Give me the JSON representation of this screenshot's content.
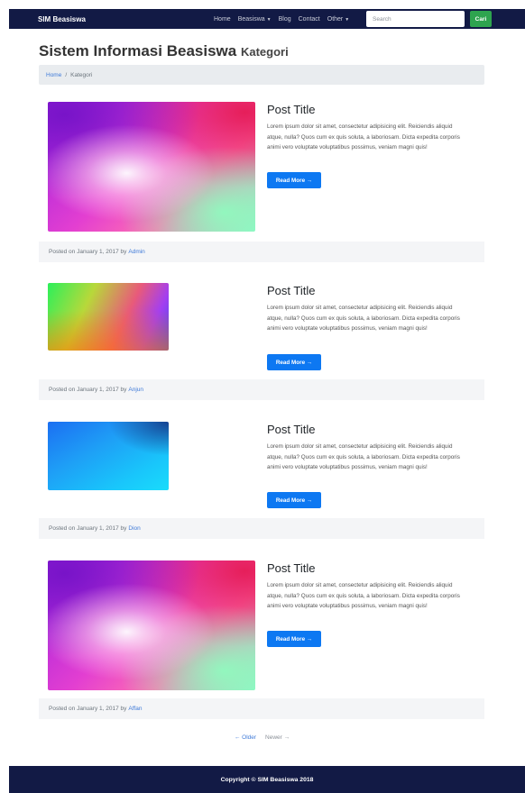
{
  "navbar": {
    "brand": "SIM Beasiswa",
    "links": [
      {
        "label": "Home"
      },
      {
        "label": "Beasiswa",
        "dropdown": true
      },
      {
        "label": "Blog"
      },
      {
        "label": "Contact"
      },
      {
        "label": "Other",
        "dropdown": true
      }
    ],
    "search_placeholder": "Search",
    "search_button": "Cari"
  },
  "header": {
    "title": "Sistem Informasi Beasiswa",
    "subtitle": "Kategori"
  },
  "breadcrumb": {
    "home": "Home",
    "separator": "/",
    "current": "Kategori"
  },
  "posts": [
    {
      "title": "Post Title",
      "text": "Lorem ipsum dolor sit amet, consectetur adipisicing elit. Reiciendis aliquid atque, nulla? Quos cum ex quis soluta, a laboriosam. Dicta expedita corporis animi vero voluptate voluptatibus possimus, veniam magni quis!",
      "button": "Read More →",
      "posted": "Posted on January 1, 2017 by",
      "author": "Admin"
    },
    {
      "title": "Post Title",
      "text": "Lorem ipsum dolor sit amet, consectetur adipisicing elit. Reiciendis aliquid atque, nulla? Quos cum ex quis soluta, a laboriosam. Dicta expedita corporis animi vero voluptate voluptatibus possimus, veniam magni quis!",
      "button": "Read More →",
      "posted": "Posted on January 1, 2017 by",
      "author": "Anjun"
    },
    {
      "title": "Post Title",
      "text": "Lorem ipsum dolor sit amet, consectetur adipisicing elit. Reiciendis aliquid atque, nulla? Quos cum ex quis soluta, a laboriosam. Dicta expedita corporis animi vero voluptate voluptatibus possimus, veniam magni quis!",
      "button": "Read More →",
      "posted": "Posted on January 1, 2017 by",
      "author": "Dion"
    },
    {
      "title": "Post Title",
      "text": "Lorem ipsum dolor sit amet, consectetur adipisicing elit. Reiciendis aliquid atque, nulla? Quos cum ex quis soluta, a laboriosam. Dicta expedita corporis animi vero voluptate voluptatibus possimus, veniam magni quis!",
      "button": "Read More →",
      "posted": "Posted on January 1, 2017 by",
      "author": "Affan"
    }
  ],
  "pager": {
    "older": "← Older",
    "newer": "Newer →"
  },
  "footer": {
    "copyright": "Copyright © SIM Beasiswa 2018"
  }
}
